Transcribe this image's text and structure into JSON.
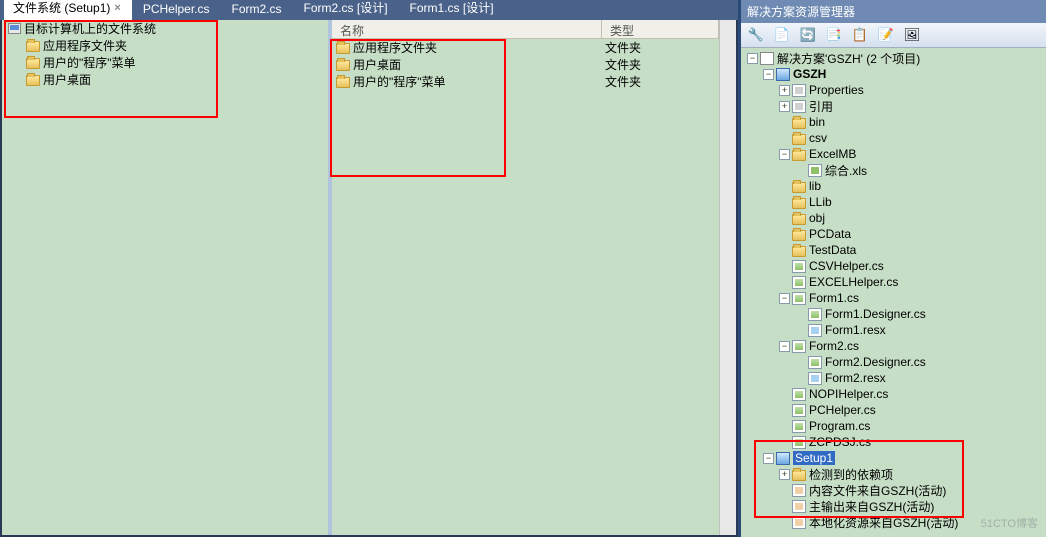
{
  "tabs": [
    {
      "label": "文件系统 (Setup1)",
      "active": true
    },
    {
      "label": "PCHelper.cs"
    },
    {
      "label": "Form2.cs"
    },
    {
      "label": "Form2.cs [设计]"
    },
    {
      "label": "Form1.cs [设计]"
    }
  ],
  "fs_tree": {
    "root": "目标计算机上的文件系统",
    "children": [
      "应用程序文件夹",
      "用户的\"程序\"菜单",
      "用户桌面"
    ]
  },
  "list_header": {
    "name": "名称",
    "type": "类型"
  },
  "list_rows": [
    {
      "name": "应用程序文件夹",
      "type": "文件夹"
    },
    {
      "name": "用户桌面",
      "type": "文件夹"
    },
    {
      "name": "用户的\"程序\"菜单",
      "type": "文件夹"
    }
  ],
  "solution": {
    "title": "解决方案资源管理器",
    "root": "解决方案'GSZH' (2 个项目)",
    "toolbar_icons": [
      "properties-icon",
      "show-all-icon",
      "refresh-icon",
      "nest-icon",
      "copy-icon",
      "view-code-icon",
      "view-designer-icon"
    ],
    "nodes": [
      {
        "lvl": 0,
        "exp": "-",
        "ico": "solution",
        "text": "解决方案'GSZH' (2 个项目)",
        "key": "root"
      },
      {
        "lvl": 1,
        "exp": "-",
        "ico": "project",
        "text": "GSZH",
        "bold": true
      },
      {
        "lvl": 2,
        "exp": "+",
        "ico": "cfg",
        "text": "Properties"
      },
      {
        "lvl": 2,
        "exp": "+",
        "ico": "cfg",
        "text": "引用"
      },
      {
        "lvl": 2,
        "exp": "",
        "ico": "folder",
        "text": "bin"
      },
      {
        "lvl": 2,
        "exp": "",
        "ico": "folder",
        "text": "csv"
      },
      {
        "lvl": 2,
        "exp": "-",
        "ico": "folder",
        "text": "ExcelMB"
      },
      {
        "lvl": 3,
        "exp": "",
        "ico": "xls",
        "text": "综合.xls"
      },
      {
        "lvl": 2,
        "exp": "",
        "ico": "folder",
        "text": "lib"
      },
      {
        "lvl": 2,
        "exp": "",
        "ico": "folder",
        "text": "LLib"
      },
      {
        "lvl": 2,
        "exp": "",
        "ico": "folder",
        "text": "obj"
      },
      {
        "lvl": 2,
        "exp": "",
        "ico": "folder",
        "text": "PCData"
      },
      {
        "lvl": 2,
        "exp": "",
        "ico": "folder",
        "text": "TestData"
      },
      {
        "lvl": 2,
        "exp": "",
        "ico": "cs",
        "text": "CSVHelper.cs"
      },
      {
        "lvl": 2,
        "exp": "",
        "ico": "cs",
        "text": "EXCELHelper.cs"
      },
      {
        "lvl": 2,
        "exp": "-",
        "ico": "cs",
        "text": "Form1.cs"
      },
      {
        "lvl": 3,
        "exp": "",
        "ico": "cs",
        "text": "Form1.Designer.cs"
      },
      {
        "lvl": 3,
        "exp": "",
        "ico": "resx",
        "text": "Form1.resx"
      },
      {
        "lvl": 2,
        "exp": "-",
        "ico": "cs",
        "text": "Form2.cs"
      },
      {
        "lvl": 3,
        "exp": "",
        "ico": "cs",
        "text": "Form2.Designer.cs"
      },
      {
        "lvl": 3,
        "exp": "",
        "ico": "resx",
        "text": "Form2.resx"
      },
      {
        "lvl": 2,
        "exp": "",
        "ico": "cs",
        "text": "NOPIHelper.cs"
      },
      {
        "lvl": 2,
        "exp": "",
        "ico": "cs",
        "text": "PCHelper.cs"
      },
      {
        "lvl": 2,
        "exp": "",
        "ico": "cs",
        "text": "Program.cs"
      },
      {
        "lvl": 2,
        "exp": "",
        "ico": "cs",
        "text": "ZCPDSJ.cs"
      },
      {
        "lvl": 1,
        "exp": "-",
        "ico": "project",
        "text": "Setup1",
        "selected": true
      },
      {
        "lvl": 2,
        "exp": "+",
        "ico": "folder",
        "text": "检测到的依赖项"
      },
      {
        "lvl": 2,
        "exp": "",
        "ico": "out",
        "text": "内容文件来自GSZH(活动)"
      },
      {
        "lvl": 2,
        "exp": "",
        "ico": "out",
        "text": "主输出来自GSZH(活动)"
      },
      {
        "lvl": 2,
        "exp": "",
        "ico": "out",
        "text": "本地化资源来自GSZH(活动)"
      }
    ]
  },
  "watermark": "51CTO博客"
}
